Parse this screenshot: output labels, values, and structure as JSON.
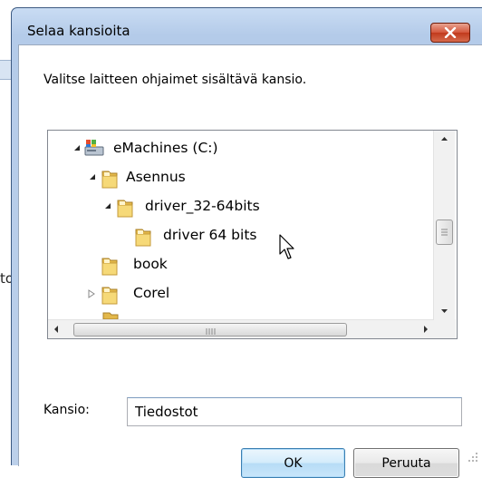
{
  "background": {
    "partial_text": "to"
  },
  "dialog": {
    "title": "Selaa kansioita",
    "instruction": "Valitse laitteen ohjaimet sisältävä kansio.",
    "tree": {
      "items": [
        {
          "label": "eMachines (C:)",
          "level": 0,
          "expanded": true,
          "icon": "drive-icon"
        },
        {
          "label": "Asennus",
          "level": 1,
          "expanded": true,
          "icon": "folder-icon"
        },
        {
          "label": "driver_32-64bits",
          "level": 2,
          "expanded": true,
          "icon": "folder-icon"
        },
        {
          "label": "driver 64 bits",
          "level": 3,
          "expanded": false,
          "icon": "folder-icon"
        },
        {
          "label": "book",
          "level": 1,
          "expanded": false,
          "icon": "folder-icon"
        },
        {
          "label": "Corel",
          "level": 1,
          "expanded": false,
          "collapsed_arrow": true,
          "icon": "folder-icon"
        }
      ]
    },
    "folder_field": {
      "label": "Kansio:",
      "value": "Tiedostot"
    },
    "buttons": {
      "ok": "OK",
      "cancel": "Peruuta"
    }
  },
  "colors": {
    "title_gradient": "#c9dcf3",
    "close_button": "#c1391c",
    "ok_border": "#3c7fb1"
  }
}
